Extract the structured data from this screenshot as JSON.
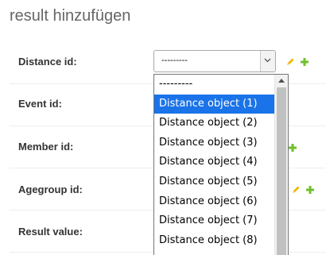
{
  "title": "result hinzufügen",
  "form": {
    "fields": [
      {
        "label": "Distance id:"
      },
      {
        "label": "Event id:"
      },
      {
        "label": "Member id:"
      },
      {
        "label": "Agegroup id:"
      },
      {
        "label": "Result value:"
      }
    ],
    "distance_select": {
      "value": "---------",
      "options": [
        "---------",
        "Distance object (1)",
        "Distance object (2)",
        "Distance object (3)",
        "Distance object (4)",
        "Distance object (5)",
        "Distance object (6)",
        "Distance object (7)",
        "Distance object (8)"
      ],
      "selected_index": 1
    }
  },
  "icons": {
    "edit": "pencil-icon",
    "add": "plus-icon",
    "dropdown": "chevron-down-icon",
    "scroll_up": "arrow-up-icon"
  },
  "colors": {
    "highlight": "#1a73e8",
    "add_icon": "#70bf2b",
    "edit_icon": "#efb80b"
  }
}
